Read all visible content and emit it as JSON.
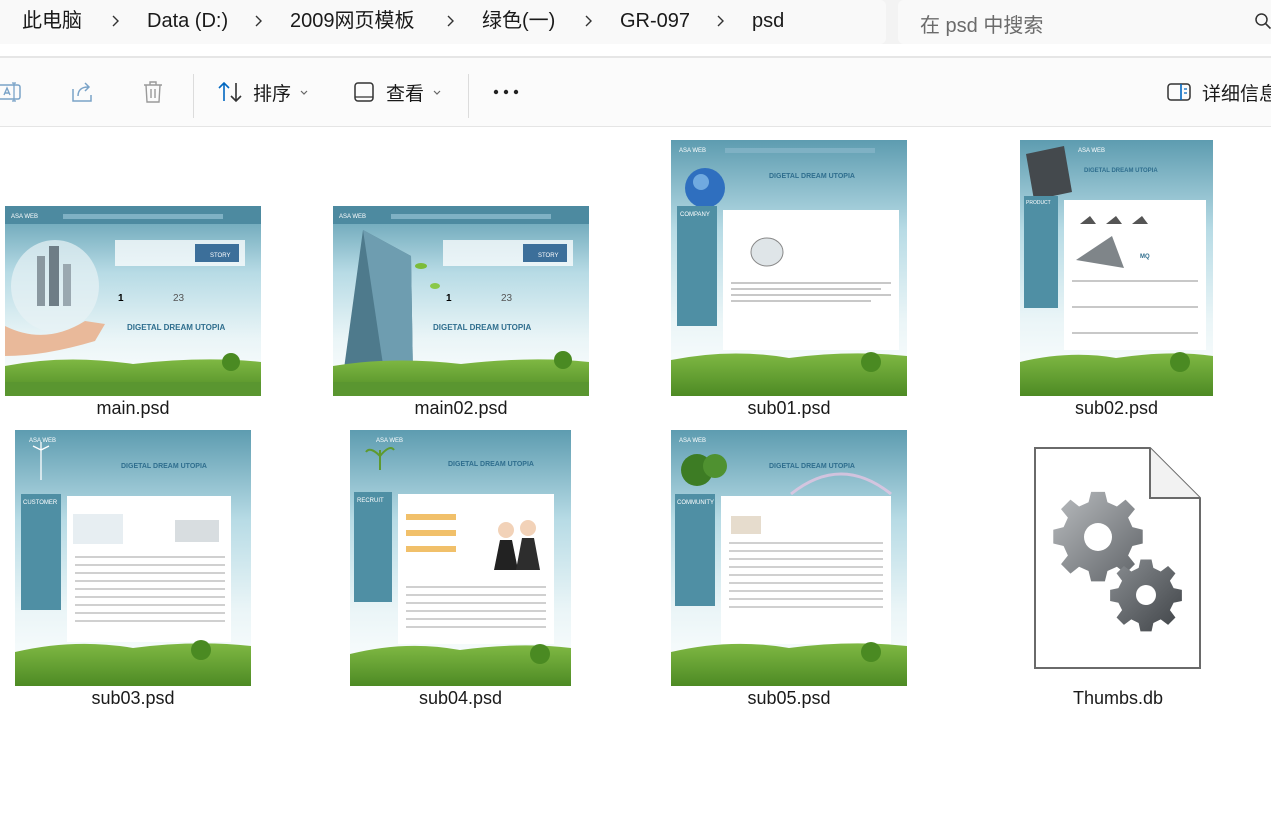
{
  "breadcrumb": {
    "items": [
      "此电脑",
      "Data (D:)",
      "2009网页模板",
      "绿色(一)",
      "GR-097",
      "psd"
    ],
    "separator_icon": "chevron-right-icon"
  },
  "search": {
    "placeholder": "在 psd 中搜索",
    "icon": "search-icon"
  },
  "toolbar": {
    "rename_icon": "rename-icon",
    "share_icon": "share-icon",
    "delete_icon": "trash-icon",
    "sort_label": "排序",
    "view_label": "查看",
    "more_label": "...",
    "details_label": "详细信息"
  },
  "files": [
    {
      "name": "main.psd",
      "type": "psd-thumbnail",
      "brand": "ASA WEB",
      "headline": "DIGETAL DREAM UTOPIA",
      "badge": "STORY"
    },
    {
      "name": "main02.psd",
      "type": "psd-thumbnail",
      "brand": "ASA WEB",
      "headline": "DIGETAL DREAM UTOPIA",
      "badge": "STORY"
    },
    {
      "name": "sub01.psd",
      "type": "psd-thumbnail",
      "brand": "ASA WEB",
      "headline": "DIGETAL DREAM UTOPIA",
      "section": "COMPANY"
    },
    {
      "name": "sub02.psd",
      "type": "psd-thumbnail",
      "brand": "ASA WEB",
      "headline": "DIGETAL DREAM UTOPIA",
      "section": "PRODUCT"
    },
    {
      "name": "sub03.psd",
      "type": "psd-thumbnail",
      "brand": "ASA WEB",
      "headline": "DIGETAL DREAM UTOPIA",
      "section": "CUSTOMER"
    },
    {
      "name": "sub04.psd",
      "type": "psd-thumbnail",
      "brand": "ASA WEB",
      "headline": "DIGETAL DREAM UTOPIA",
      "section": "RECRUIT"
    },
    {
      "name": "sub05.psd",
      "type": "psd-thumbnail",
      "brand": "ASA WEB",
      "headline": "DIGETAL DREAM UTOPIA",
      "section": "COMMUNITY"
    },
    {
      "name": "Thumbs.db",
      "type": "system-file",
      "icon": "gear-file-icon"
    }
  ],
  "colors": {
    "accent": "#0067c0",
    "sky": "#cfe7ee",
    "grass": "#5e9a2e"
  }
}
